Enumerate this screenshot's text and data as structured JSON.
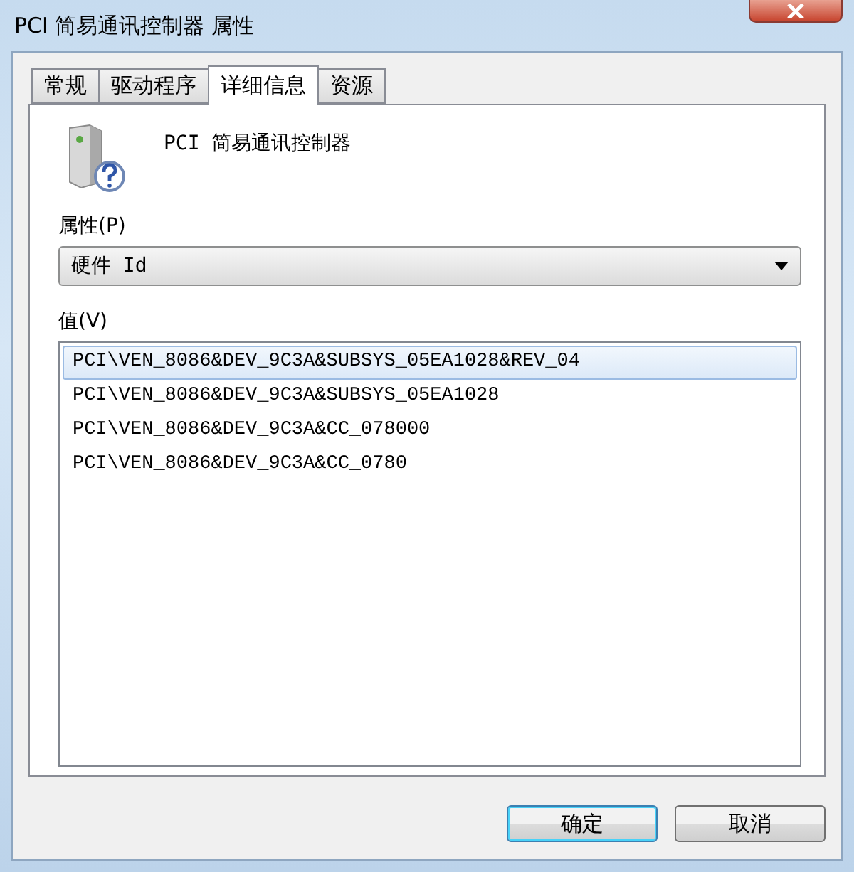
{
  "window": {
    "title": "PCI 简易通讯控制器 属性"
  },
  "tabs": [
    {
      "label": "常规",
      "selected": false
    },
    {
      "label": "驱动程序",
      "selected": false
    },
    {
      "label": "详细信息",
      "selected": true
    },
    {
      "label": "资源",
      "selected": false
    }
  ],
  "device": {
    "name": "PCI 简易通讯控制器"
  },
  "property": {
    "label": "属性(P)",
    "value": "硬件 Id"
  },
  "values": {
    "label": "值(V)",
    "items": [
      {
        "text": "PCI\\VEN_8086&DEV_9C3A&SUBSYS_05EA1028&REV_04",
        "selected": true
      },
      {
        "text": "PCI\\VEN_8086&DEV_9C3A&SUBSYS_05EA1028",
        "selected": false
      },
      {
        "text": "PCI\\VEN_8086&DEV_9C3A&CC_078000",
        "selected": false
      },
      {
        "text": "PCI\\VEN_8086&DEV_9C3A&CC_0780",
        "selected": false
      }
    ]
  },
  "buttons": [
    {
      "label": "确定",
      "kind": "default"
    },
    {
      "label": "取消",
      "kind": "normal"
    }
  ]
}
